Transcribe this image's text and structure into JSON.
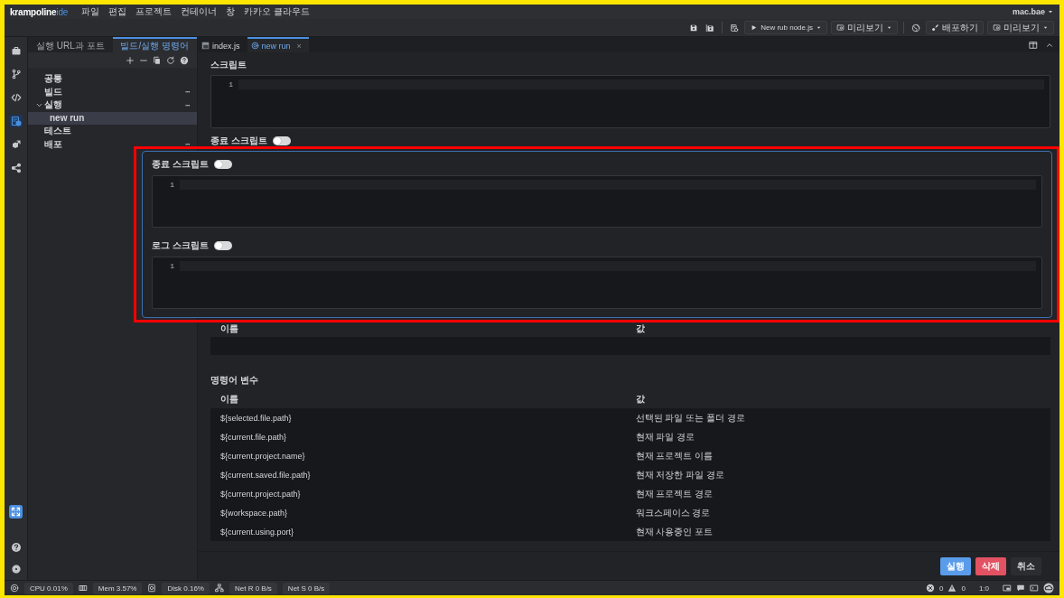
{
  "menu_bar": {
    "logo": {
      "name": "krampoline",
      "suffix": "ide"
    },
    "items": [
      "파일",
      "편집",
      "프로젝트",
      "컨테이너",
      "창",
      "카카오 클라우드"
    ],
    "user": "mac.bae"
  },
  "toolbar": {
    "items": [
      {
        "kind": "dropdown",
        "label": "New rub node.js"
      },
      {
        "kind": "dropdown",
        "label": "미리보기"
      },
      {
        "kind": "button",
        "label": "배포하기"
      },
      {
        "kind": "dropdown",
        "label": "미리보기"
      }
    ]
  },
  "activity_bar": {
    "items": [
      {
        "selected": false
      },
      {
        "selected": false
      },
      {
        "selected": false
      },
      {
        "selected": true
      },
      {
        "selected": false
      },
      {
        "selected": false
      }
    ]
  },
  "sidebar": {
    "tabs": [
      {
        "label": "실행 URL과 포트",
        "selected": false
      },
      {
        "label": "빌드/실행 명령어",
        "selected": true
      }
    ],
    "tree": [
      {
        "label": "공통",
        "selected": false
      },
      {
        "label": "빌드",
        "selected": false,
        "more": "···"
      },
      {
        "label": "실행",
        "selected": false,
        "expanded": true,
        "more": "···",
        "children": [
          {
            "label": "new run",
            "selected": true
          }
        ]
      },
      {
        "label": "테스트",
        "selected": false
      },
      {
        "label": "배포",
        "selected": false,
        "more": "···"
      }
    ]
  },
  "editor": {
    "tabs": [
      {
        "label": "index.js",
        "selected": false
      },
      {
        "label": "new run",
        "selected": true,
        "close": "×"
      }
    ],
    "script": {
      "label": "스크립트",
      "line": "1"
    },
    "stop_script": {
      "label": "종료 스크립트",
      "on": false
    },
    "env_table": {
      "columns": [
        "이름",
        "값"
      ]
    },
    "command_variables": {
      "label": "명령어 변수",
      "columns": [
        "이름",
        "값"
      ],
      "rows": [
        [
          "${selected.file.path}",
          "선택된 파일 또는 폴더 경로"
        ],
        [
          "${current.file.path}",
          "현재 파일 경로"
        ],
        [
          "${current.project.name}",
          "현재 프로젝트 이름"
        ],
        [
          "${current.saved.file.path}",
          "현재 저장한 파일 경로"
        ],
        [
          "${current.project.path}",
          "현재 프로젝트 경로"
        ],
        [
          "${workspace.path}",
          "워크스페이스 경로"
        ],
        [
          "${current.using.port}",
          "현재 사용중인 포트"
        ]
      ]
    },
    "buttons": [
      {
        "label": "실행",
        "kind": "primary"
      },
      {
        "label": "삭제",
        "kind": "danger"
      },
      {
        "label": "취소",
        "kind": "plain"
      }
    ]
  },
  "highlight_panel": {
    "sections": [
      {
        "label": "종료 스크립트",
        "on": false,
        "line": "1"
      },
      {
        "label": "로그 스크립트",
        "on": false,
        "line": "1"
      }
    ]
  },
  "status_bar": {
    "items": [
      "CPU 0.01%",
      "Mem 3.57%",
      "Disk 0.16%",
      "Net R 0 B/s",
      "Net S 0 B/s"
    ],
    "errors": "0",
    "warnings": "0",
    "position": "1:0"
  }
}
